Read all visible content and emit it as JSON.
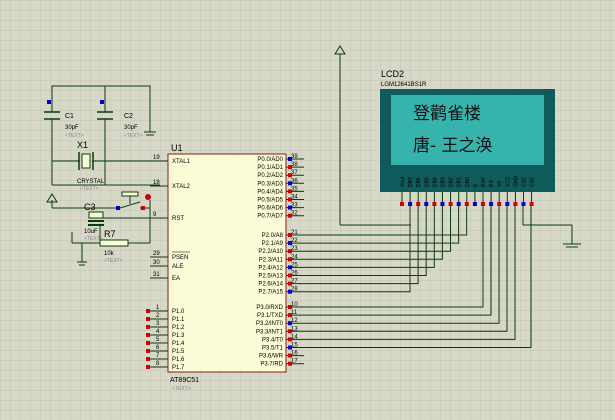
{
  "colors": {
    "background": "#d8d8c8",
    "grid": "#c3c3b4",
    "wire": "#0a3b0a",
    "ic_body": "#fbfbd7",
    "ic_border": "#8b1a1a",
    "pin_red": "#d00000",
    "pin_blue": "#0000d0",
    "lcd_bezel": "#0f5a5a",
    "lcd_screen": "#37b3ae"
  },
  "mcu": {
    "ref": "U1",
    "part": "AT89C51",
    "text_tag": "<TEXT>",
    "left_pins": [
      {
        "num": "19",
        "name": "XTAL1"
      },
      {
        "num": "18",
        "name": "XTAL2"
      },
      {
        "num": "9",
        "name": "RST"
      },
      {
        "num": "29",
        "name": "PSEN"
      },
      {
        "num": "30",
        "name": "ALE"
      },
      {
        "num": "31",
        "name": "EA"
      },
      {
        "num": "1",
        "name": "P1.0"
      },
      {
        "num": "2",
        "name": "P1.1"
      },
      {
        "num": "3",
        "name": "P1.2"
      },
      {
        "num": "4",
        "name": "P1.3"
      },
      {
        "num": "5",
        "name": "P1.4"
      },
      {
        "num": "6",
        "name": "P1.5"
      },
      {
        "num": "7",
        "name": "P1.6"
      },
      {
        "num": "8",
        "name": "P1.7"
      }
    ],
    "right_pins": [
      {
        "num": "39",
        "name": "P0.0/AD0"
      },
      {
        "num": "38",
        "name": "P0.1/AD1"
      },
      {
        "num": "37",
        "name": "P0.2/AD2"
      },
      {
        "num": "36",
        "name": "P0.3/AD3"
      },
      {
        "num": "35",
        "name": "P0.4/AD4"
      },
      {
        "num": "34",
        "name": "P0.5/AD5"
      },
      {
        "num": "33",
        "name": "P0.6/AD6"
      },
      {
        "num": "32",
        "name": "P0.7/AD7"
      },
      {
        "num": "21",
        "name": "P2.0/A8"
      },
      {
        "num": "22",
        "name": "P2.1/A9"
      },
      {
        "num": "23",
        "name": "P2.2/A10"
      },
      {
        "num": "24",
        "name": "P2.3/A11"
      },
      {
        "num": "25",
        "name": "P2.4/A12"
      },
      {
        "num": "26",
        "name": "P2.5/A13"
      },
      {
        "num": "27",
        "name": "P2.6/A14"
      },
      {
        "num": "28",
        "name": "P2.7/A15"
      },
      {
        "num": "10",
        "name": "P3.0/RXD"
      },
      {
        "num": "11",
        "name": "P3.1/TXD"
      },
      {
        "num": "12",
        "name": "P3.2/INT0"
      },
      {
        "num": "13",
        "name": "P3.3/INT1"
      },
      {
        "num": "14",
        "name": "P3.4/T0"
      },
      {
        "num": "15",
        "name": "P3.5/T1"
      },
      {
        "num": "16",
        "name": "P3.6/WR"
      },
      {
        "num": "17",
        "name": "P3.7/RD"
      }
    ]
  },
  "lcd": {
    "ref": "LCD2",
    "part": "LGM12641BS1R",
    "line1": "登鹳雀楼",
    "line2": "唐- 王之涣",
    "pins": [
      "Vout",
      "DB7",
      "DB6",
      "DB5",
      "DB4",
      "DB3",
      "DB2",
      "DB1",
      "DB0",
      "E",
      "R/W",
      "RS",
      "V0",
      "VCC",
      "GND",
      "CS2",
      "CS1"
    ]
  },
  "components": {
    "c1": {
      "ref": "C1",
      "value": "30pF",
      "tag": "<TEXT>"
    },
    "c2": {
      "ref": "C2",
      "value": "30pF",
      "tag": "<TEXT>"
    },
    "x1": {
      "ref": "X1",
      "value": "CRYSTAL",
      "tag": "<TEXT>"
    },
    "c3": {
      "ref": "C3",
      "value": "10uF",
      "tag": "<TEXT>"
    },
    "r7": {
      "ref": "R7",
      "value": "10k",
      "tag": "<TEXT>"
    }
  }
}
